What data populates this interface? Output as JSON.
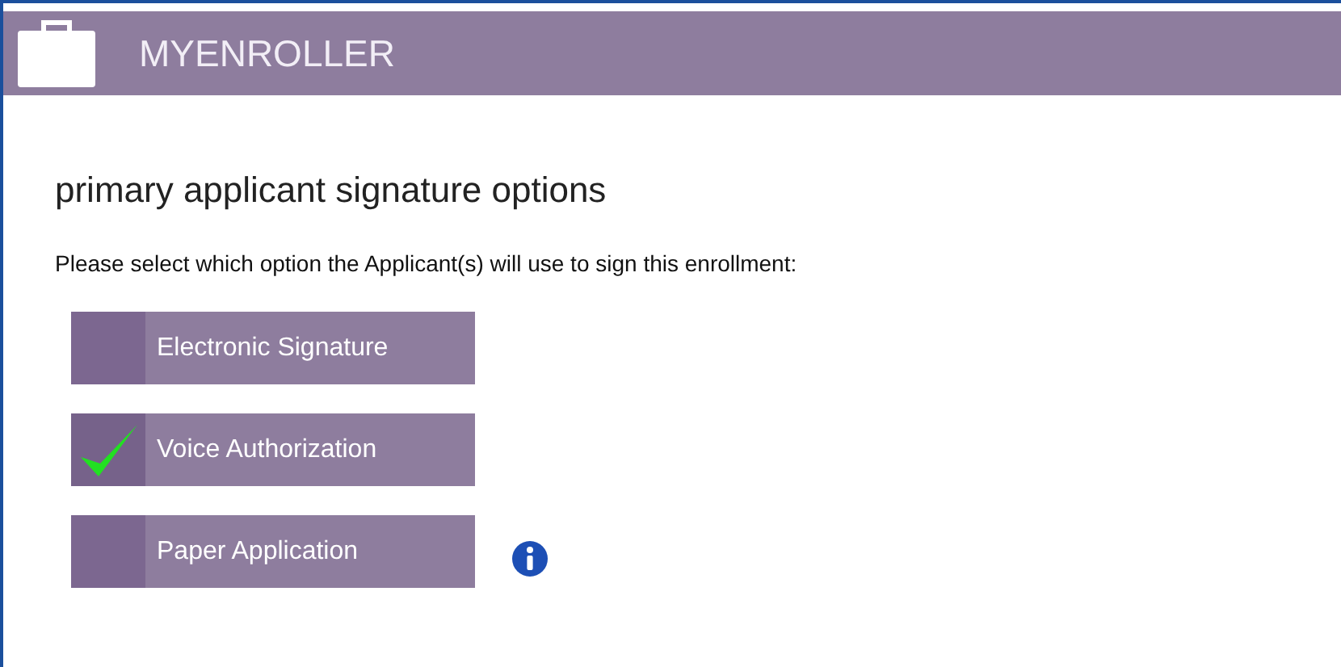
{
  "header": {
    "title": "MYENROLLER"
  },
  "heading": "primary applicant signature options",
  "instruction": "Please select which option the Applicant(s) will use to sign this enrollment:",
  "options": [
    {
      "label": "Electronic Signature",
      "selected": false,
      "info": false
    },
    {
      "label": "Voice Authorization",
      "selected": true,
      "info": false
    },
    {
      "label": "Paper Application",
      "selected": false,
      "info": true
    }
  ]
}
